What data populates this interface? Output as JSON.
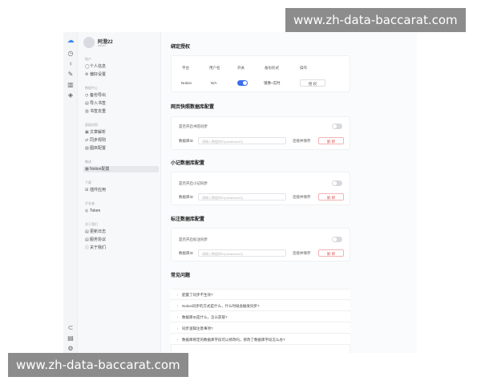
{
  "user": {
    "name": "阿澄22",
    "sub": "admin"
  },
  "nav": {
    "sections": [
      {
        "title": "账户",
        "items": [
          {
            "icon": "user-icon",
            "glyph": "◯",
            "label": "个人信息"
          },
          {
            "icon": "sliders-icon",
            "glyph": "⚙",
            "label": "偏好设置"
          }
        ]
      },
      {
        "title": "数据中心",
        "items": [
          {
            "icon": "backup-icon",
            "glyph": "◷",
            "label": "备份导出"
          },
          {
            "icon": "import-icon",
            "glyph": "▤",
            "label": "导入书签"
          },
          {
            "icon": "bookshelf-icon",
            "glyph": "▥",
            "label": "书签去重"
          }
        ]
      },
      {
        "title": "超级快照",
        "items": [
          {
            "icon": "article-icon",
            "glyph": "▣",
            "label": "文章解析"
          },
          {
            "icon": "sync-rule-icon",
            "glyph": "⇄",
            "label": "同步规则"
          },
          {
            "icon": "image-icon",
            "glyph": "▨",
            "label": "图床配置"
          }
        ]
      },
      {
        "title": "集成",
        "items": [
          {
            "icon": "notion-icon",
            "glyph": "▩",
            "label": "Notion配置",
            "active": true
          }
        ]
      },
      {
        "title": "下载",
        "items": [
          {
            "icon": "apps-icon",
            "glyph": "⊞",
            "label": "插件应用"
          }
        ]
      },
      {
        "title": "开发者",
        "items": [
          {
            "icon": "token-icon",
            "glyph": "◎",
            "label": "Token"
          }
        ]
      },
      {
        "title": "关于我们",
        "items": [
          {
            "icon": "changelog-icon",
            "glyph": "▤",
            "label": "更新日志"
          },
          {
            "icon": "terms-icon",
            "glyph": "▤",
            "label": "服务协议"
          },
          {
            "icon": "info-icon",
            "glyph": "ⓘ",
            "label": "关于我们"
          }
        ]
      }
    ]
  },
  "rail_icons": [
    "cloud-icon",
    "clock-icon",
    "lightbulb-icon",
    "pen-icon",
    "bars-icon",
    "tag-icon",
    "link-icon",
    "file-icon",
    "settings-icon"
  ],
  "bind_section": {
    "title": "绑定授权",
    "headers": [
      "平台",
      "用户名",
      "开关",
      "备份形式",
      "操作"
    ],
    "row": {
      "platform": "Notion",
      "username": "N/A",
      "backup": "镜像+实时",
      "action": "授 权",
      "enabled": true
    }
  },
  "web_db": {
    "title": "网页快照数据库配置",
    "toggle_label": "是否开启书签同步",
    "db_label": "数据库ID",
    "placeholder": "请输入数据库ID(databaseID)",
    "connect": "连接并保存",
    "unbind": "解 绑"
  },
  "note_db": {
    "title": "小记数据库配置",
    "toggle_label": "是否开启小记同步",
    "db_label": "数据库ID",
    "placeholder": "请输入数据库ID(databaseID)",
    "connect": "连接并保存",
    "unbind": "解 绑"
  },
  "mark_db": {
    "title": "标注数据库配置",
    "toggle_label": "是否开启标注同步",
    "db_label": "数据库ID",
    "placeholder": "请输入数据库ID(databaseID)",
    "connect": "连接并保存",
    "unbind": "解 绑"
  },
  "faq": {
    "title": "常见问题",
    "items": [
      "配置了同步不生效?",
      "Notion同步的方式是什么，什么时候会触发同步?",
      "数据库ID是什么，怎么获取?",
      "同步逻辑注意事项?",
      "数据库绑定的数据库字段可以修改吗，修改了数据库字段怎么办?"
    ]
  },
  "watermark": {
    "top": "www.zh-data-baccarat.com",
    "bottom": "www.zh-data-baccarat.com"
  }
}
